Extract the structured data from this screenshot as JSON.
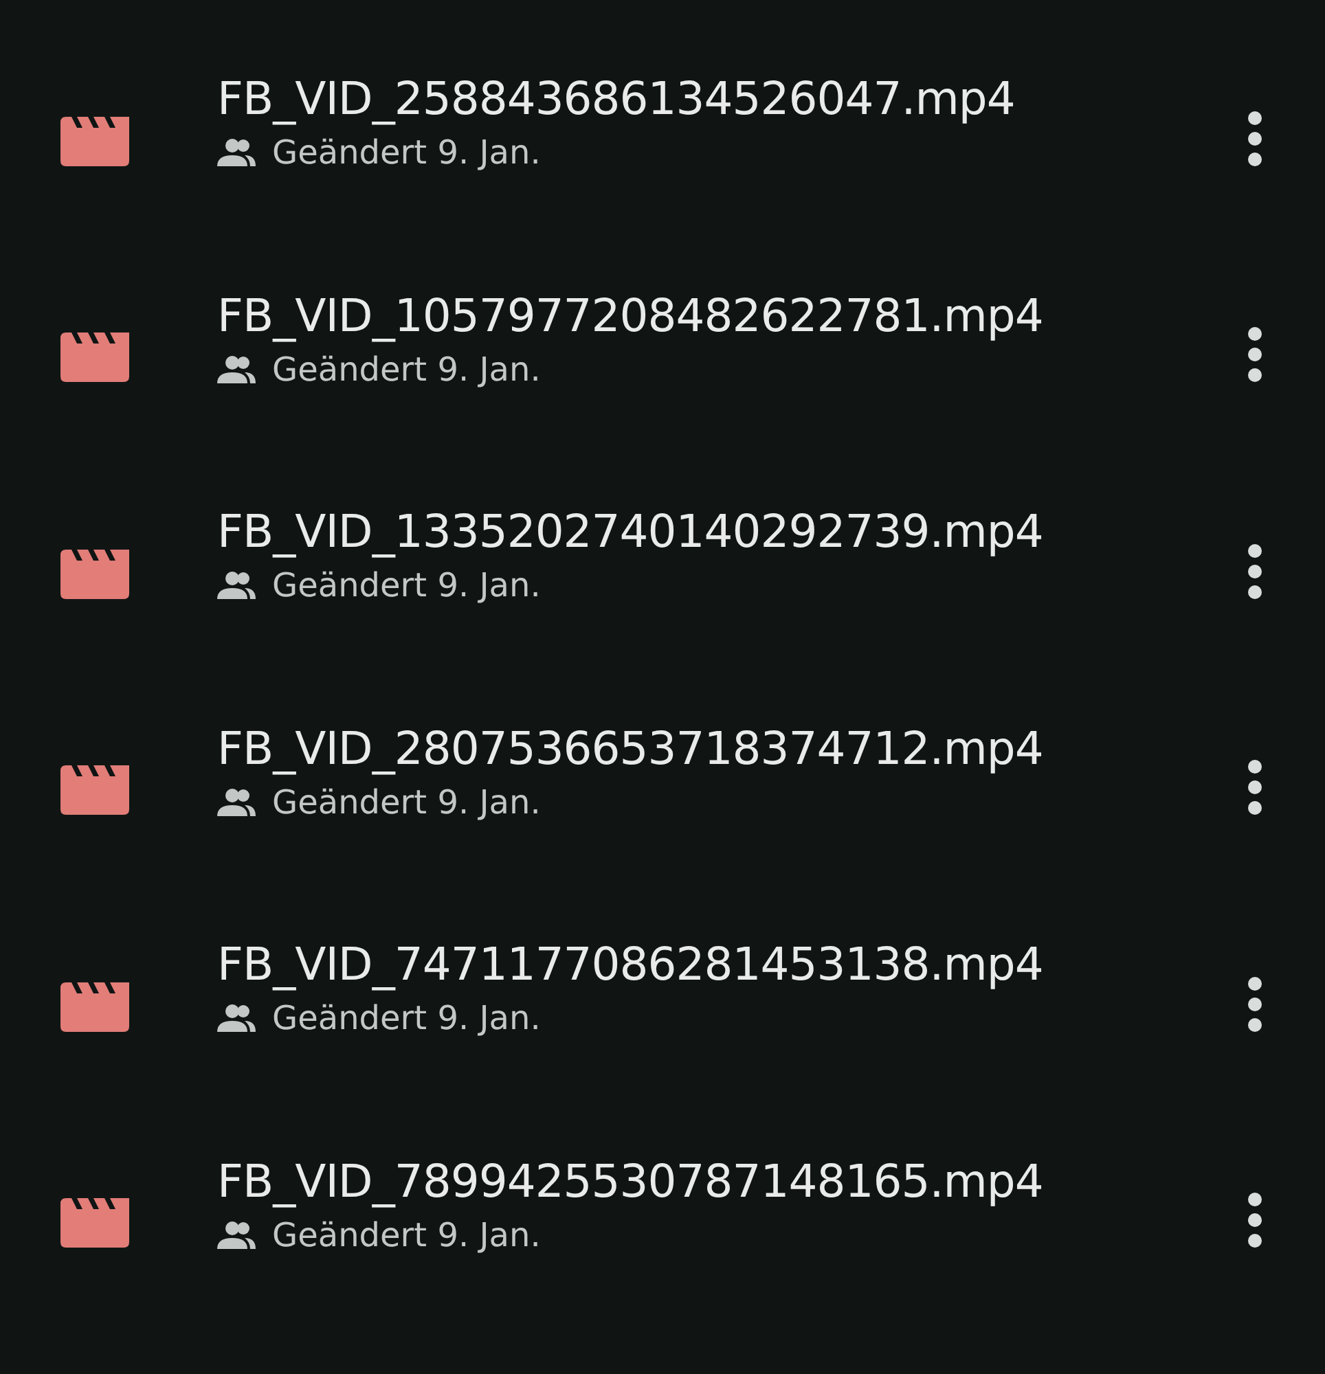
{
  "files": [
    {
      "name": "FB_VID_258843686134526047.mp4",
      "shared": true,
      "modified": "Geändert 9. Jan."
    },
    {
      "name": "FB_VID_1057977208482622781.mp4",
      "shared": true,
      "modified": "Geändert 9. Jan."
    },
    {
      "name": "FB_VID_1335202740140292739.mp4",
      "shared": true,
      "modified": "Geändert 9. Jan."
    },
    {
      "name": "FB_VID_2807536653718374712.mp4",
      "shared": true,
      "modified": "Geändert 9. Jan."
    },
    {
      "name": "FB_VID_7471177086281453138.mp4",
      "shared": true,
      "modified": "Geändert 9. Jan."
    },
    {
      "name": "FB_VID_7899425530787148165.mp4",
      "shared": true,
      "modified": "Geändert 9. Jan."
    }
  ]
}
